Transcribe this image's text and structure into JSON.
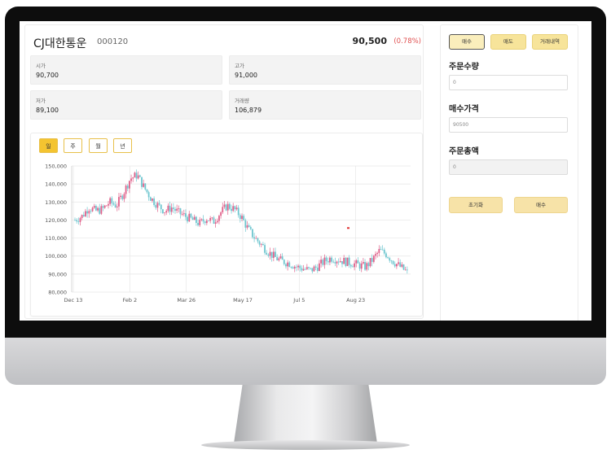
{
  "stock": {
    "name": "CJ대한통운",
    "code": "000120",
    "price": "90,500",
    "change": "(0.78%)",
    "open_label": "시가",
    "open_value": "90,700",
    "high_label": "고가",
    "high_value": "91,000",
    "low_label": "저가",
    "low_value": "89,100",
    "volume_label": "거래량",
    "volume_value": "106,879"
  },
  "periods": [
    "일",
    "주",
    "월",
    "년"
  ],
  "active_period": "일",
  "colors": {
    "up": "#e0608a",
    "down": "#6ec6cf",
    "accent": "#f4c430",
    "change": "#e05050"
  },
  "chart_data": {
    "type": "candlestick",
    "y_ticks": [
      "150,000",
      "140,000",
      "130,000",
      "120,000",
      "110,000",
      "100,000",
      "90,000",
      "80,000"
    ],
    "x_ticks": [
      "Dec 13",
      "Feb 2",
      "Mar 26",
      "May 17",
      "Jul 5",
      "Aug 23"
    ],
    "ylim": [
      80000,
      150000
    ],
    "close_path": [
      120000,
      122000,
      127000,
      125000,
      126000,
      130000,
      128000,
      135000,
      143000,
      145000,
      138000,
      132000,
      128000,
      125000,
      127000,
      124000,
      122000,
      120000,
      118000,
      121000,
      119000,
      124000,
      128000,
      126000,
      122000,
      115000,
      110000,
      106000,
      102000,
      99000,
      97000,
      96000,
      94000,
      93000,
      92000,
      94000,
      97000,
      99000,
      98000,
      97000,
      96000,
      95000,
      94000,
      98000,
      103000,
      101000,
      97000,
      94000,
      91000
    ],
    "grid": true
  },
  "order": {
    "tabs": [
      "매수",
      "매도",
      "거래내역"
    ],
    "active_tab": "매수",
    "qty_label": "주문수량",
    "qty_value": "0",
    "price_label": "매수가격",
    "price_value": "90500",
    "total_label": "주문총액",
    "total_value": "0",
    "reset_label": "초기화",
    "submit_label": "매수"
  }
}
